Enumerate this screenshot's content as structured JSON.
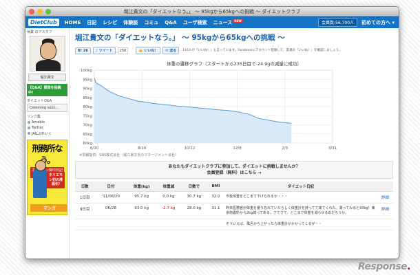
{
  "window": {
    "title": "堀江貴文の「ダイエットなう。」 〜 95kgから65kgへの挑戦 〜 ダイエットクラブ"
  },
  "nav": {
    "logo": "DietClub",
    "items": [
      "HOME",
      "日記",
      "レシピ",
      "体験談",
      "コミュ",
      "Q&A",
      "ユーザ検索",
      "ニュース"
    ],
    "new_badge": "NEW",
    "member_count": "会員数:56,700人",
    "first_time": "初めての方へ",
    "first_time_icon": "chevron-down-icon"
  },
  "sidebar": {
    "header": "休業 のアスダフ",
    "name": "堀江貴文",
    "qa_banner": "【Q&A】質問を投稿中！",
    "qa_label": "ダイエットQ&A",
    "qa_item": "Comming soon...",
    "links_label": "リンク集",
    "links": [
      "Ameblo",
      "Twitter",
      "JAILぷれいく"
    ],
    "ad": {
      "title": "刑務所なう。",
      "sub": "ホリエモン獄中日記195日",
      "box": "ホリエモン初の漫画化!",
      "manga": "マンガ"
    }
  },
  "page": {
    "title": "堀江貴文の「ダイエットなう。」 〜 95kgから65kgへの挑戦 〜",
    "hatena_count": "26",
    "tweet_label": "ツイート",
    "tweet_count": "250",
    "like_label": "いいね！",
    "send_label": "送る",
    "like_count": "116",
    "fb_text": "116人が「いいね！」と言っています。Facebookにアカウント登録して、友達の「いいね！」を確認しましょう。"
  },
  "chart_data": {
    "type": "area",
    "title": "体重の遷移グラフ（スタートから235日目で-24.9gの減量に成功）",
    "xlabel": "",
    "ylabel": "",
    "x_ticks": [
      "6/20",
      "8/16",
      "10/12",
      "12/8",
      "2/3",
      "3/31"
    ],
    "y_ticks": [
      "60kg",
      "65kg",
      "70kg",
      "75kg",
      "80kg",
      "85kg",
      "90kg",
      "95kg",
      "100kg"
    ],
    "ylim": [
      60,
      100
    ],
    "x_day_range": [
      0,
      284
    ],
    "grid": true,
    "fill_color": "#d8e9f7",
    "line_color": "#5b9ad5",
    "series": [
      {
        "x": [
          0,
          2,
          8,
          14,
          20,
          28,
          36,
          44,
          52,
          60,
          70,
          80,
          90,
          100,
          112,
          124,
          136,
          148,
          160,
          172,
          184,
          196,
          208,
          220,
          235
        ],
        "y": [
          95.7,
          93.0,
          91.5,
          89.5,
          87.8,
          86.2,
          85.0,
          84.0,
          83.0,
          82.5,
          81.8,
          81.2,
          80.8,
          80.2,
          79.8,
          79.3,
          78.8,
          78.2,
          77.8,
          77.0,
          75.8,
          73.5,
          72.5,
          71.5,
          70.8
        ]
      }
    ]
  },
  "chart_caption": "※情報提供：SNS株式会社（堀江貴文氏のマネージメント会社）",
  "cta": {
    "line1": "あなたもダイエットクラブに参加して、ダイエットに挑戦しませんか？",
    "line2": "会員登録（無料）はこちら →"
  },
  "table": {
    "headers": [
      "日数",
      "日付",
      "体重(kg)",
      "体重減",
      "日数で",
      "BMI",
      "ダイエット日記",
      ""
    ],
    "rows": [
      [
        "1日目",
        "'11/06/20",
        "95.7 kg",
        "0.0 kg",
        "30.7 kg",
        "32.0",
        "今後体重をどこまで下げられるか・・・",
        "詳細"
      ],
      [
        "9日目",
        "06/28",
        "93.0 kg",
        "-2.7 kg",
        "28.0 kg",
        "31.1",
        "昨日医務官が体重を量り忘れていたらしく体重計を持ってて来てくれた。測ってみると93kg！東京拘置所から2kg減ってある。さてさて、どこまで体重を減らせるのだろうか。",
        "詳細"
      ],
      [
        "",
        "",
        "",
        "",
        "",
        "",
        "そういえば、風呂から上がったら体重計がかかってくるが・・",
        ""
      ]
    ]
  },
  "watermark": {
    "brand": "Response",
    "dot": "."
  }
}
